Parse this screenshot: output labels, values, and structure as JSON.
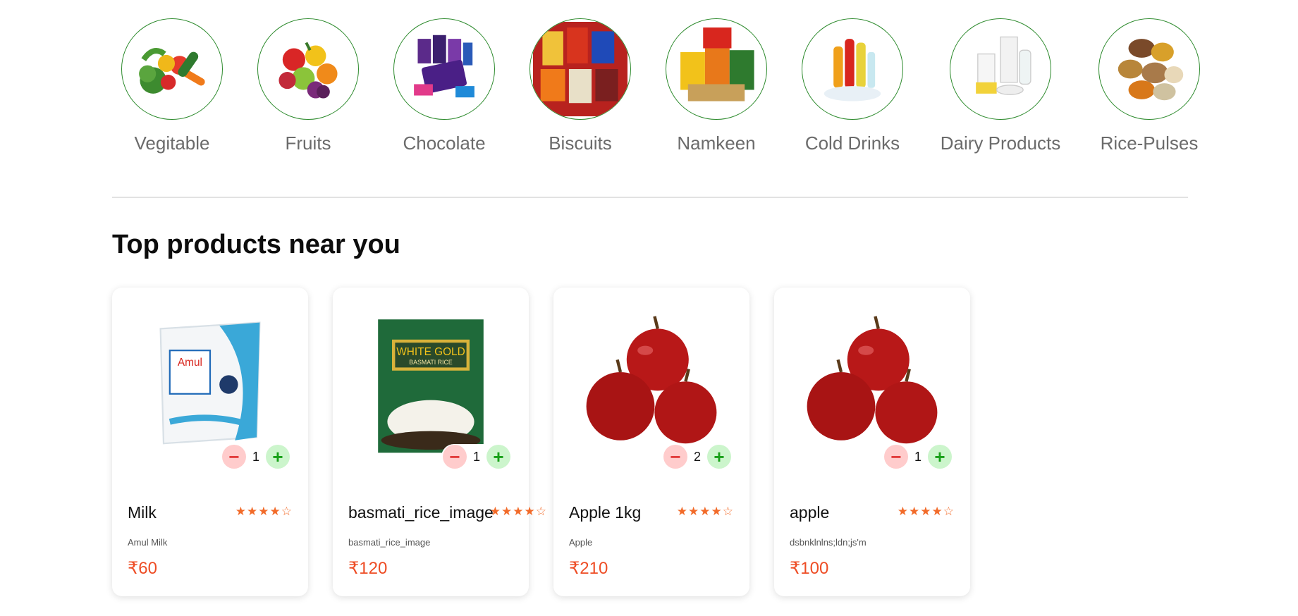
{
  "categories": [
    {
      "label": "Vegitable",
      "icon": "vegetable-basket-icon"
    },
    {
      "label": "Fruits",
      "icon": "fruit-pile-icon"
    },
    {
      "label": "Chocolate",
      "icon": "chocolate-box-icon"
    },
    {
      "label": "Biscuits",
      "icon": "biscuit-packs-icon"
    },
    {
      "label": "Namkeen",
      "icon": "namkeen-packs-icon"
    },
    {
      "label": "Cold Drinks",
      "icon": "cold-drink-bottles-icon"
    },
    {
      "label": "Dairy Products",
      "icon": "dairy-items-icon"
    },
    {
      "label": "Rice-Pulses",
      "icon": "grain-piles-icon"
    }
  ],
  "section": {
    "title": "Top products near you"
  },
  "products": [
    {
      "name": "Milk",
      "description": "Amul Milk",
      "price": "₹60",
      "quantity": "1",
      "rating": 4,
      "rating_max": 5,
      "stars_text": "★★★★☆",
      "image": "milk-pouch-icon"
    },
    {
      "name": "basmati_rice_image",
      "description": "basmati_rice_image",
      "price": "₹120",
      "quantity": "1",
      "rating": 4,
      "rating_max": 5,
      "stars_text": "★★★★☆",
      "image": "rice-bag-icon"
    },
    {
      "name": "Apple 1kg",
      "description": "Apple",
      "price": "₹210",
      "quantity": "2",
      "rating": 4,
      "rating_max": 5,
      "stars_text": "★★★★☆",
      "image": "apples-icon"
    },
    {
      "name": "apple",
      "description": "dsbnklnlns;ldn;js'm",
      "price": "₹100",
      "quantity": "1",
      "rating": 4,
      "rating_max": 5,
      "stars_text": "★★★★☆",
      "image": "apples-icon"
    }
  ],
  "controls": {
    "minus_symbol": "−",
    "plus_symbol": "+"
  },
  "colors": {
    "accent_green": "#2e8b2e",
    "price_red": "#ee4d25",
    "star_orange": "#f26b2a",
    "minus_bg": "#ffcccc",
    "plus_bg": "#ccf5cc"
  }
}
